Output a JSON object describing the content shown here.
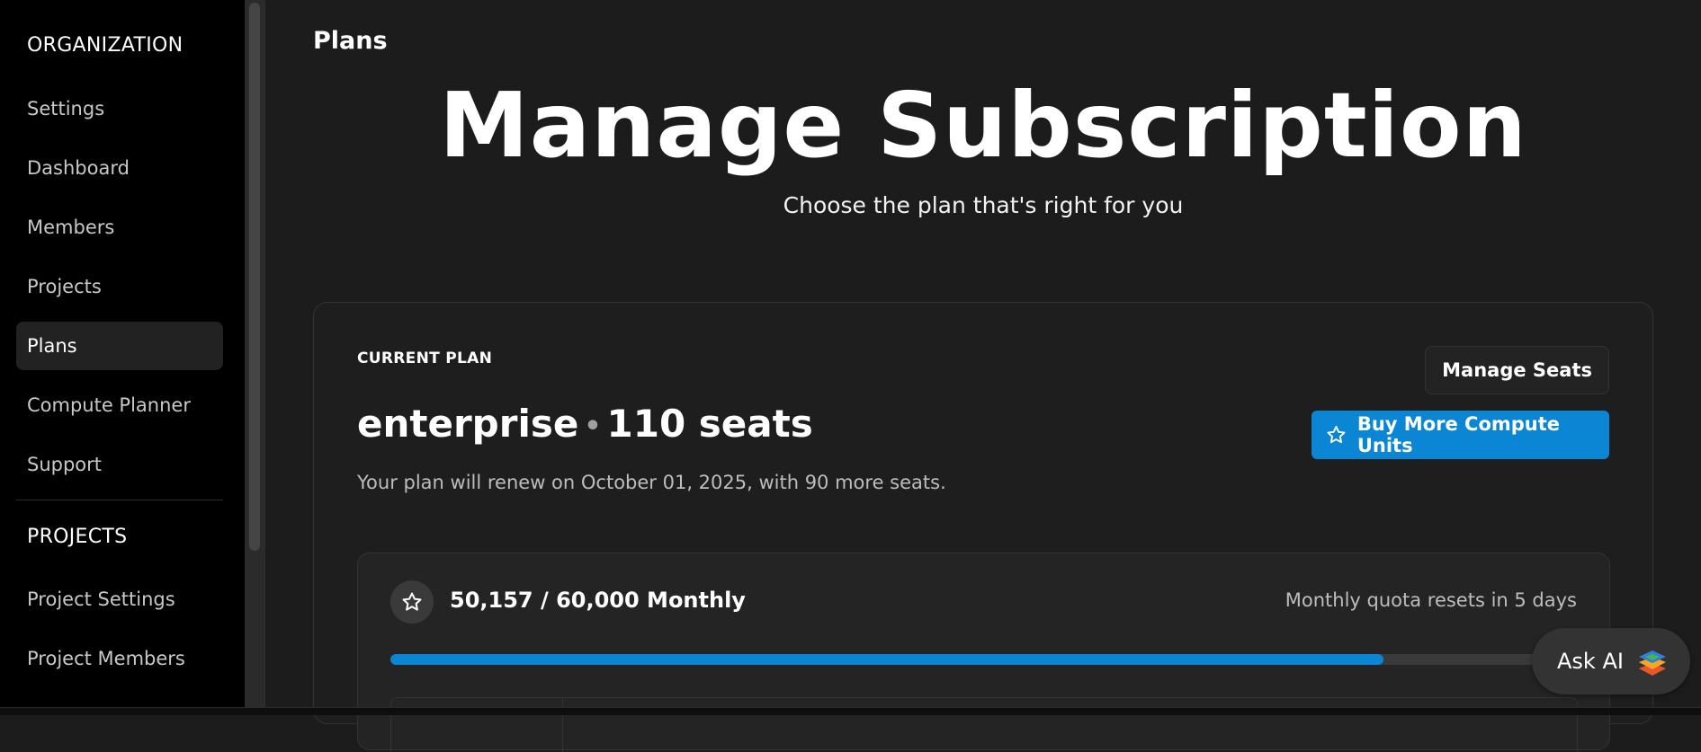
{
  "sidebar": {
    "organization_heading": "ORGANIZATION",
    "org_items": [
      {
        "label": "Settings"
      },
      {
        "label": "Dashboard"
      },
      {
        "label": "Members"
      },
      {
        "label": "Projects"
      },
      {
        "label": "Plans",
        "active": true
      },
      {
        "label": "Compute Planner"
      },
      {
        "label": "Support"
      }
    ],
    "projects_heading": "PROJECTS",
    "project_items": [
      {
        "label": "Project Settings"
      },
      {
        "label": "Project Members"
      }
    ]
  },
  "main": {
    "breadcrumb_title": "Plans",
    "hero_title": "Manage Subscription",
    "hero_subtitle": "Choose the plan that's right for you"
  },
  "plan": {
    "current_plan_label": "CURRENT PLAN",
    "tier": "enterprise",
    "separator": "•",
    "seats": "110 seats",
    "renewal_text": "Your plan will renew on October 01, 2025, with 90 more seats.",
    "manage_seats_label": "Manage Seats",
    "buy_compute_label": "Buy More Compute Units"
  },
  "usage": {
    "value_text": "50,157 / 60,000 Monthly",
    "reset_text": "Monthly quota resets in 5 days",
    "used": 50157,
    "total": 60000,
    "progress_fraction": 0.836
  },
  "ask_ai": {
    "label": "Ask AI"
  },
  "colors": {
    "accent": "#0a86d4",
    "sidebar_bg": "#000000",
    "page_bg": "#1c1c1c"
  },
  "icons": {
    "usage": "star-outline-icon",
    "buy": "star-outline-icon",
    "ask_ai": "layered-diamond-logo-icon"
  }
}
